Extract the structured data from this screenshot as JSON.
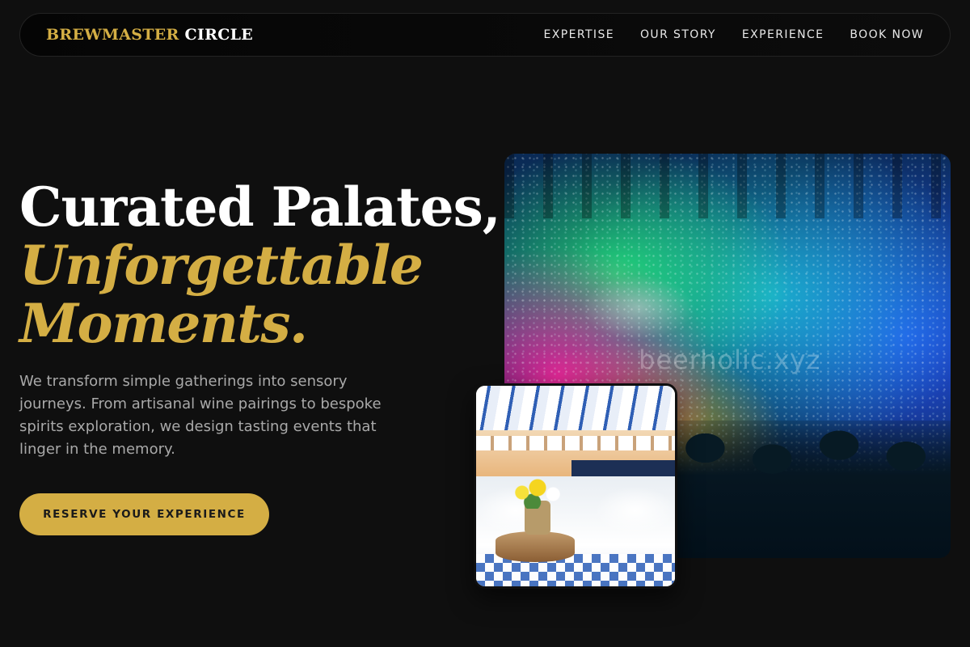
{
  "brand": {
    "part1": "BREWMASTER",
    "part2": "CIRCLE"
  },
  "nav": {
    "links": [
      "EXPERTISE",
      "OUR STORY",
      "EXPERIENCE",
      "BOOK NOW"
    ]
  },
  "hero": {
    "title_line1": "Curated Palates,",
    "title_line2": "Unforgettable",
    "title_line3": "Moments.",
    "description": "We transform simple gatherings into sensory journeys. From artisanal wine pairings to bespoke spirits exploration, we design tasting events that linger in the memory.",
    "cta_label": "RESERVE YOUR EXPERIENCE"
  },
  "images": {
    "concert_watermark": "beerholic.xyz"
  },
  "colors": {
    "accent": "#d4ae44",
    "background": "#0f0f0f",
    "text_muted": "#a9a9a9"
  }
}
